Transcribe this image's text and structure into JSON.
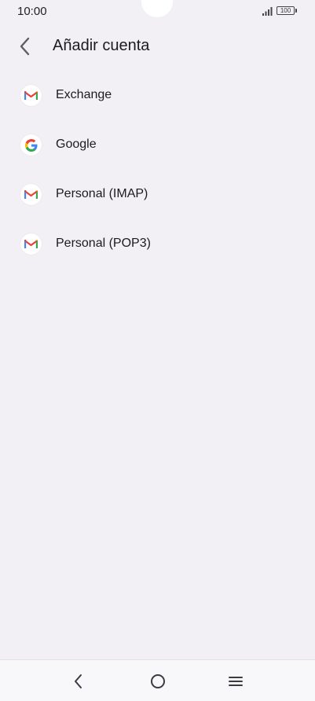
{
  "status_bar": {
    "time": "10:00",
    "battery": "100",
    "icons": [
      "signal-icon",
      "battery-icon"
    ]
  },
  "header": {
    "title": "Añadir cuenta",
    "back_icon": "chevron-left-icon"
  },
  "accounts": [
    {
      "label": "Exchange",
      "icon": "gmail-icon"
    },
    {
      "label": "Google",
      "icon": "google-icon"
    },
    {
      "label": "Personal (IMAP)",
      "icon": "gmail-icon"
    },
    {
      "label": "Personal (POP3)",
      "icon": "gmail-icon"
    }
  ],
  "nav_bar": {
    "icons": [
      "back-icon",
      "home-icon",
      "recents-icon"
    ]
  },
  "colors": {
    "background": "#f2f0f4",
    "text": "#1c1b1f",
    "gmail_red": "#ea4335",
    "gmail_blue": "#4285f4",
    "gmail_green": "#34a853",
    "gmail_yellow": "#fbbc04"
  }
}
